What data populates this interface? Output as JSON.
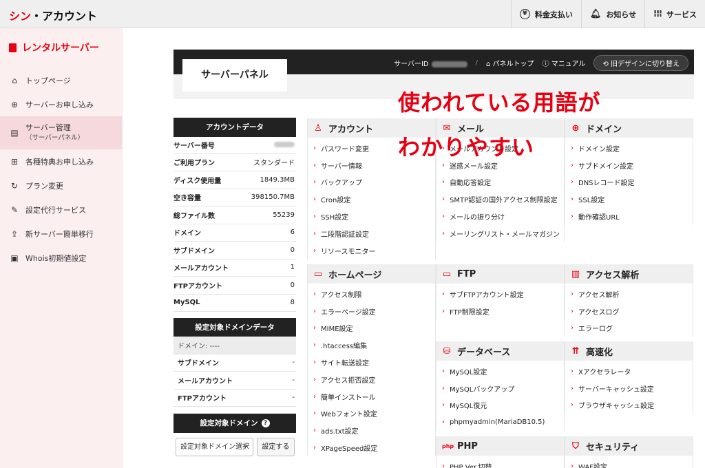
{
  "topbar": {
    "logo_red": "シン",
    "logo_dark": "・アカウント",
    "nav": [
      {
        "icon": "yen-icon",
        "label": "料金支払い"
      },
      {
        "icon": "bell-icon",
        "label": "お知らせ"
      },
      {
        "icon": "grid-icon",
        "label": "サービス"
      }
    ]
  },
  "sidebar": {
    "title": "レンタルサーバー",
    "items": [
      {
        "icon": "home-icon",
        "label": "トップページ"
      },
      {
        "icon": "plus-circle-icon",
        "label": "サーバーお申し込み"
      },
      {
        "icon": "server-icon",
        "label": "サーバー管理",
        "sub": "（サーバーパネル）",
        "active": true
      },
      {
        "icon": "gift-icon",
        "label": "各種特典お申し込み"
      },
      {
        "icon": "refresh-icon",
        "label": "プラン変更"
      },
      {
        "icon": "wrench-icon",
        "label": "設定代行サービス"
      },
      {
        "icon": "upload-icon",
        "label": "新サーバー簡単移行"
      },
      {
        "icon": "document-icon",
        "label": "Whois初期値設定"
      }
    ]
  },
  "header": {
    "panel_title": "サーバーパネル",
    "server_id_label": "サーバーID",
    "panel_top": "パネルトップ",
    "manual": "マニュアル",
    "old_design": "旧デザインに切り替え"
  },
  "overlay": {
    "line1": "使われている用語が",
    "line2": "わかりやすい"
  },
  "account_data": {
    "title": "アカウントデータ",
    "rows": [
      {
        "k": "サーバー番号",
        "v": ""
      },
      {
        "k": "ご利用プラン",
        "v": "スタンダード"
      },
      {
        "k": "ディスク使用量",
        "v": "1849.3MB"
      },
      {
        "k": "空き容量",
        "v": "398150.7MB"
      },
      {
        "k": "総ファイル数",
        "v": "55239"
      },
      {
        "k": "ドメイン",
        "v": "6"
      },
      {
        "k": "サブドメイン",
        "v": "0"
      },
      {
        "k": "メールアカウント",
        "v": "1"
      },
      {
        "k": "FTPアカウント",
        "v": "0"
      },
      {
        "k": "MySQL",
        "v": "8"
      }
    ]
  },
  "domain_data": {
    "title": "設定対象ドメインデータ",
    "domain_line": "ドメイン: ----",
    "rows": [
      {
        "k": "サブドメイン",
        "v": "-"
      },
      {
        "k": "メールアカウント",
        "v": "-"
      },
      {
        "k": "FTPアカウント",
        "v": "-"
      }
    ]
  },
  "domain_select": {
    "title": "設定対象ドメイン",
    "select_value": "設定対象ドメイン選択",
    "button": "設定する"
  },
  "sections": {
    "account": {
      "title": "アカウント",
      "items": [
        "パスワード変更",
        "サーバー情報",
        "バックアップ",
        "Cron設定",
        "SSH設定",
        "二段階認証設定",
        "リソースモニター"
      ]
    },
    "mail": {
      "title": "メール",
      "items": [
        "メールアカウント設定",
        "迷惑メール設定",
        "自動応答設定",
        "SMTP認証の国外アクセス制限設定",
        "メールの振り分け",
        "メーリングリスト・メールマガジン"
      ]
    },
    "domain": {
      "title": "ドメイン",
      "items": [
        "ドメイン設定",
        "サブドメイン設定",
        "DNSレコード設定",
        "SSL設定",
        "動作確認URL"
      ]
    },
    "homepage": {
      "title": "ホームページ",
      "items": [
        "アクセス制限",
        "エラーページ設定",
        "MIME設定",
        ".htaccess編集",
        "サイト転送設定",
        "アクセス拒否設定",
        "簡単インストール",
        "Webフォント設定",
        "ads.txt設定",
        "XPageSpeed設定"
      ]
    },
    "ftp": {
      "title": "FTP",
      "items": [
        "サブFTPアカウント設定",
        "FTP制限設定"
      ]
    },
    "access": {
      "title": "アクセス解析",
      "items": [
        "アクセス解析",
        "アクセスログ",
        "エラーログ"
      ]
    },
    "database": {
      "title": "データベース",
      "items": [
        "MySQL設定",
        "MySQLバックアップ",
        "MySQL復元",
        "phpmyadmin(MariaDB10.5)"
      ]
    },
    "speed": {
      "title": "高速化",
      "items": [
        "Xアクセラレータ",
        "サーバーキャッシュ設定",
        "ブラウザキャッシュ設定"
      ]
    },
    "php": {
      "title": "PHP",
      "items": [
        "PHP Ver.切替"
      ]
    },
    "security": {
      "title": "セキュリティ",
      "items": [
        "WAF設定"
      ]
    }
  }
}
